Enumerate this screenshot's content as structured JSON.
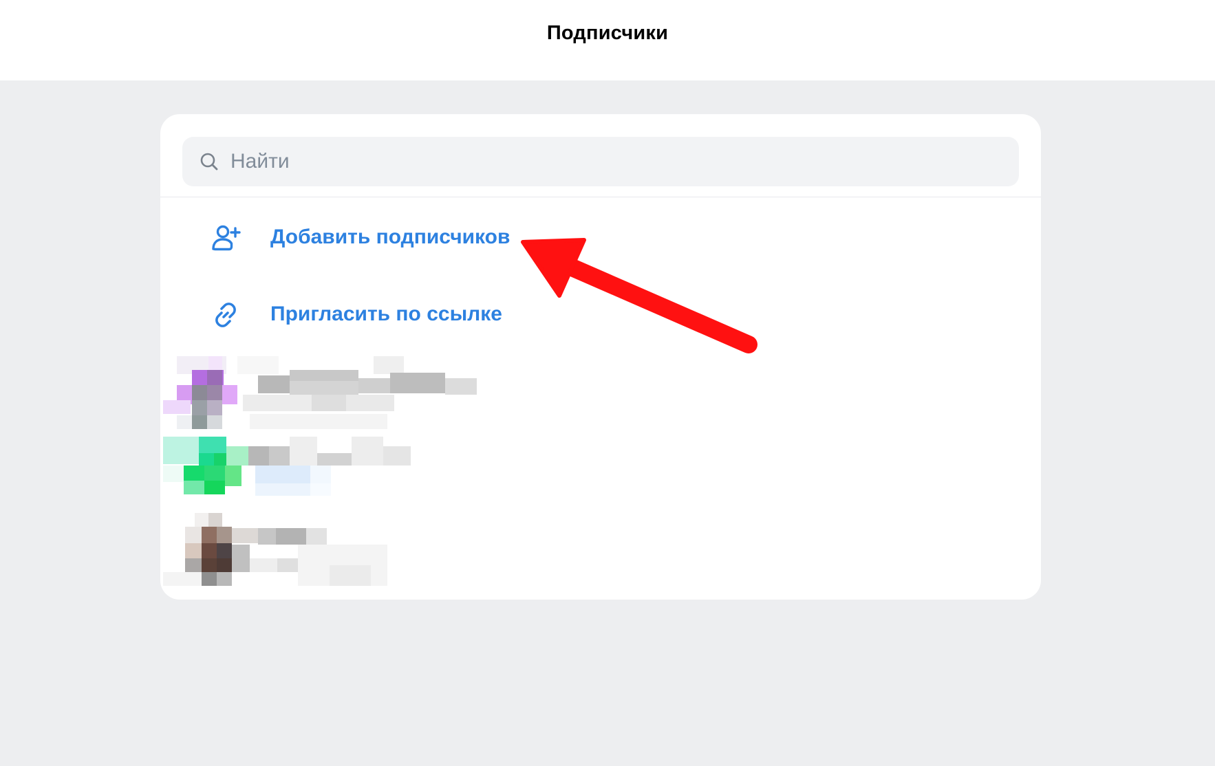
{
  "header": {
    "title": "Подписчики"
  },
  "search": {
    "placeholder": "Найти",
    "value": ""
  },
  "actions": [
    {
      "label": "Добавить подписчиков",
      "icon": "user-add-icon"
    },
    {
      "label": "Пригласить по ссылке",
      "icon": "link-icon"
    }
  ],
  "subscribers": [
    {
      "avatar_colors": [
        "#c98ce8",
        "#8e8a96",
        "#e3b0f6"
      ],
      "name_censored": true
    },
    {
      "avatar_colors": [
        "#3fe0b0",
        "#17d45a",
        "#b6f2de"
      ],
      "name_censored": true
    },
    {
      "avatar_colors": [
        "#8f6f62",
        "#4e3b36",
        "#d8c8be"
      ],
      "name_censored": true
    }
  ],
  "colors": {
    "accent": "#2d81e0",
    "background": "#edeef0",
    "annotation_arrow": "#ff1111"
  }
}
